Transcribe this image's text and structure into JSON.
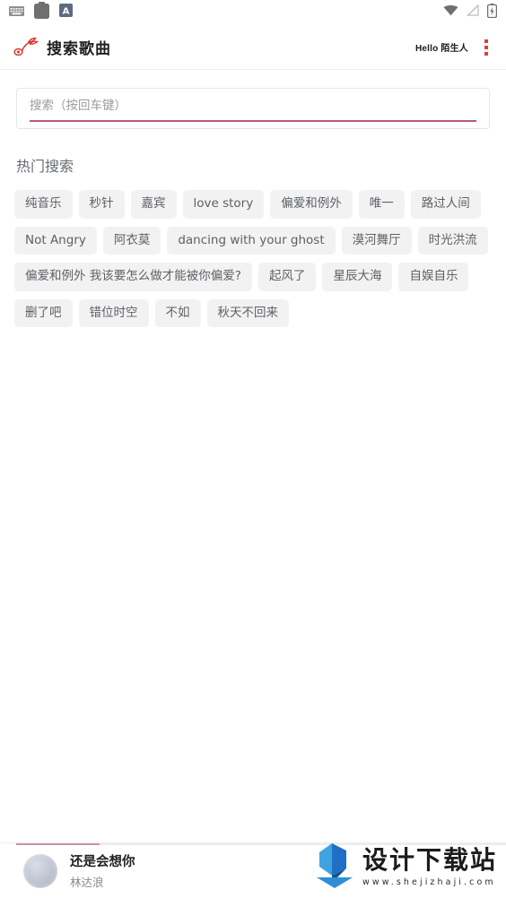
{
  "statusbar": {
    "left_icons": [
      {
        "name": "keyboard-icon"
      },
      {
        "name": "clipboard-icon"
      },
      {
        "name": "input-method-a-icon",
        "label": "A"
      }
    ],
    "right_icons": [
      {
        "name": "wifi-icon"
      },
      {
        "name": "signal-off-icon"
      },
      {
        "name": "battery-charging-icon"
      }
    ]
  },
  "header": {
    "logo_icon": "music-note-logo-icon",
    "title": "搜索歌曲",
    "greeting": "Hello 陌生人",
    "menu_icon": "kebab-menu-icon",
    "accent_color": "#e03c3c"
  },
  "search": {
    "placeholder": "搜索（按回车键）",
    "value": "",
    "underline_color": "#b8577f"
  },
  "hot_search": {
    "title": "热门搜索",
    "tags": [
      "纯音乐",
      "秒针",
      "嘉宾",
      "love story",
      "偏爱和例外",
      "唯一",
      "路过人间",
      "Not Angry",
      "阿衣莫",
      "dancing with your ghost",
      "漠河舞厅",
      "时光洪流",
      "偏爱和例外 我该要怎么做才能被你偏爱?",
      "起风了",
      "星辰大海",
      "自娱自乐",
      "删了吧",
      "错位时空",
      "不如",
      "秋天不回来"
    ]
  },
  "player": {
    "track_title": "还是会想你",
    "artist": "林达浪",
    "album_art_icon": "album-art-thumbnail",
    "progress_percent": 17,
    "progress_color": "#cf8fab"
  },
  "watermark": {
    "logo_icon": "download-site-logo-icon",
    "title": "设计下载站",
    "url": "www.shejizhaji.com"
  }
}
